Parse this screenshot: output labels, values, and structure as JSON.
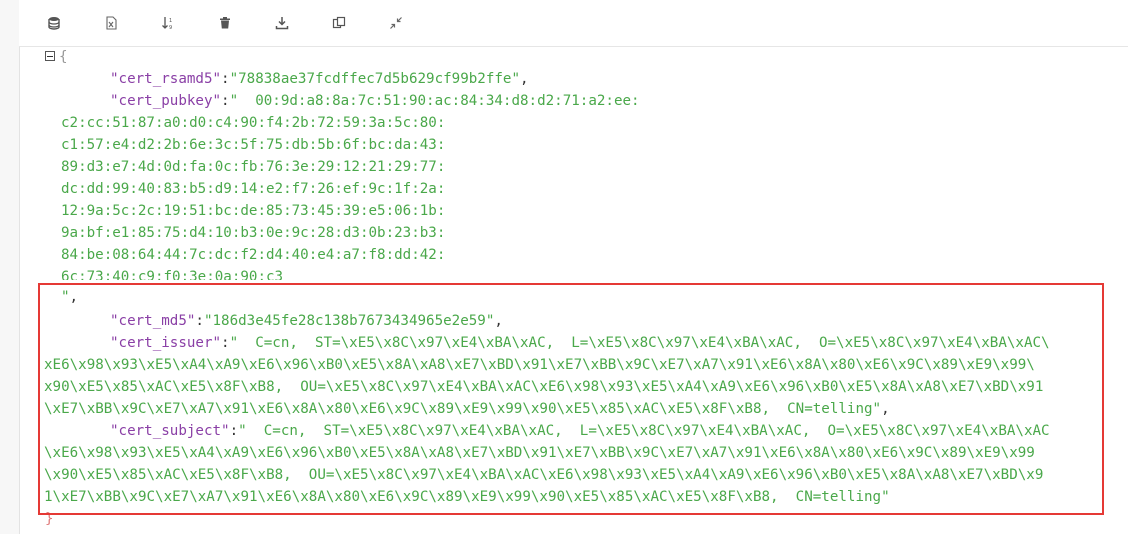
{
  "toolbar": {
    "buttons": [
      {
        "name": "database-icon"
      },
      {
        "name": "excel-icon"
      },
      {
        "name": "sort-icon"
      },
      {
        "name": "trash-icon"
      },
      {
        "name": "download-icon"
      },
      {
        "name": "copy-icon"
      },
      {
        "name": "collapse-icon"
      }
    ]
  },
  "json_view": {
    "open_brace": "{",
    "close_brace": "}",
    "rsamd5": {
      "key": "\"cert_rsamd5\"",
      "value": "\"78838ae37fcdffec7d5b629cf99b2ffe\""
    },
    "pubkey": {
      "key": "\"cert_pubkey\"",
      "first": "\"  00:9d:a8:8a:7c:51:90:ac:84:34:d8:d2:71:a2:ee:",
      "lines": [
        "c2:cc:51:87:a0:d0:c4:90:f4:2b:72:59:3a:5c:80:",
        "c1:57:e4:d2:2b:6e:3c:5f:75:db:5b:6f:bc:da:43:",
        "89:d3:e7:4d:0d:fa:0c:fb:76:3e:29:12:21:29:77:",
        "dc:dd:99:40:83:b5:d9:14:e2:f7:26:ef:9c:1f:2a:",
        "12:9a:5c:2c:19:51:bc:de:85:73:45:39:e5:06:1b:",
        "9a:bf:e1:85:75:d4:10:b3:0e:9c:28:d3:0b:23:b3:",
        "84:be:08:64:44:7c:dc:f2:d4:40:e4:a7:f8:dd:42:",
        "6c:73:40:c9:f0:3e:0a:90:c3"
      ],
      "end": "\""
    },
    "md5": {
      "key": "\"cert_md5\"",
      "value": "\"186d3e45fe28c138b7673434965e2e59\""
    },
    "issuer": {
      "key": "\"cert_issuer\"",
      "first": "\"  C=cn,  ST=\\xE5\\x8C\\x97\\xE4\\xBA\\xAC,  L=\\xE5\\x8C\\x97\\xE4\\xBA\\xAC,  O=\\xE5\\x8C\\x97\\xE4\\xBA\\xAC\\",
      "lines": [
        "xE6\\x98\\x93\\xE5\\xA4\\xA9\\xE6\\x96\\xB0\\xE5\\x8A\\xA8\\xE7\\xBD\\x91\\xE7\\xBB\\x9C\\xE7\\xA7\\x91\\xE6\\x8A\\x80\\xE6\\x9C\\x89\\xE9\\x99\\",
        "x90\\xE5\\x85\\xAC\\xE5\\x8F\\xB8,  OU=\\xE5\\x8C\\x97\\xE4\\xBA\\xAC\\xE6\\x98\\x93\\xE5\\xA4\\xA9\\xE6\\x96\\xB0\\xE5\\x8A\\xA8\\xE7\\xBD\\x91",
        "\\xE7\\xBB\\x9C\\xE7\\xA7\\x91\\xE6\\x8A\\x80\\xE6\\x9C\\x89\\xE9\\x99\\x90\\xE5\\x85\\xAC\\xE5\\x8F\\xB8,  CN=telling\""
      ]
    },
    "subject": {
      "key": "\"cert_subject\"",
      "first": "\"  C=cn,  ST=\\xE5\\x8C\\x97\\xE4\\xBA\\xAC,  L=\\xE5\\x8C\\x97\\xE4\\xBA\\xAC,  O=\\xE5\\x8C\\x97\\xE4\\xBA\\xAC",
      "lines": [
        "\\xE6\\x98\\x93\\xE5\\xA4\\xA9\\xE6\\x96\\xB0\\xE5\\x8A\\xA8\\xE7\\xBD\\x91\\xE7\\xBB\\x9C\\xE7\\xA7\\x91\\xE6\\x8A\\x80\\xE6\\x9C\\x89\\xE9\\x99",
        "\\x90\\xE5\\x85\\xAC\\xE5\\x8F\\xB8,  OU=\\xE5\\x8C\\x97\\xE4\\xBA\\xAC\\xE6\\x98\\x93\\xE5\\xA4\\xA9\\xE6\\x96\\xB0\\xE5\\x8A\\xA8\\xE7\\xBD\\x9",
        "1\\xE7\\xBB\\x9C\\xE7\\xA7\\x91\\xE6\\x8A\\x80\\xE6\\x9C\\x89\\xE9\\x99\\x90\\xE5\\x85\\xAC\\xE5\\x8F\\xB8,  CN=telling\""
      ]
    }
  },
  "colors": {
    "key": "#8a3fa6",
    "string": "#4aa84a",
    "highlight": "#e53935"
  }
}
